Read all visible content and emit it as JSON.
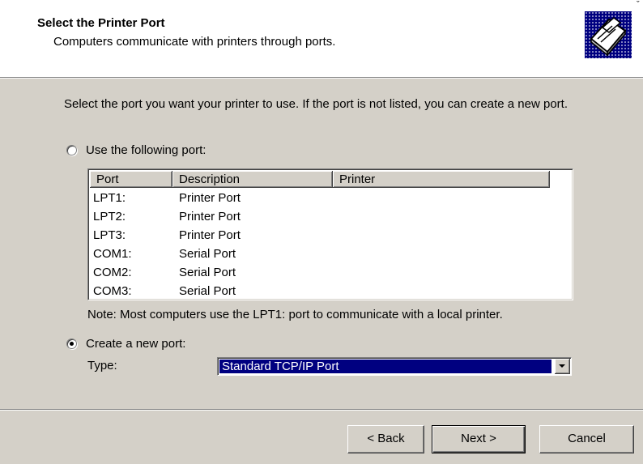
{
  "header": {
    "title": "Select the Printer Port",
    "subtitle": "Computers communicate with printers through ports.",
    "corner_mark": "ˇ"
  },
  "body": {
    "instructions": "Select the port you want your printer to use.  If the port is not listed, you can create a new port.",
    "use_port_label": "Use the following port:",
    "use_port_checked": false,
    "columns": [
      "Port",
      "Description",
      "Printer"
    ],
    "ports": [
      {
        "port": "LPT1:",
        "description": "Printer Port",
        "printer": ""
      },
      {
        "port": "LPT2:",
        "description": "Printer Port",
        "printer": ""
      },
      {
        "port": "LPT3:",
        "description": "Printer Port",
        "printer": ""
      },
      {
        "port": "COM1:",
        "description": "Serial Port",
        "printer": ""
      },
      {
        "port": "COM2:",
        "description": "Serial Port",
        "printer": ""
      },
      {
        "port": "COM3:",
        "description": "Serial Port",
        "printer": ""
      }
    ],
    "note": "Note: Most computers use the LPT1: port to communicate with a local printer.",
    "create_port_label": "Create a new port:",
    "create_port_checked": true,
    "type_label": "Type:",
    "type_value": "Standard TCP/IP Port"
  },
  "footer": {
    "back_label": "< Back",
    "next_label": "Next >",
    "cancel_label": "Cancel"
  },
  "colors": {
    "dialog_bg": "#d4d0c8",
    "selection": "#000080"
  },
  "icons": [
    "printer-icon",
    "scroll-up-icon",
    "scroll-down-icon",
    "dropdown-arrow-icon"
  ]
}
